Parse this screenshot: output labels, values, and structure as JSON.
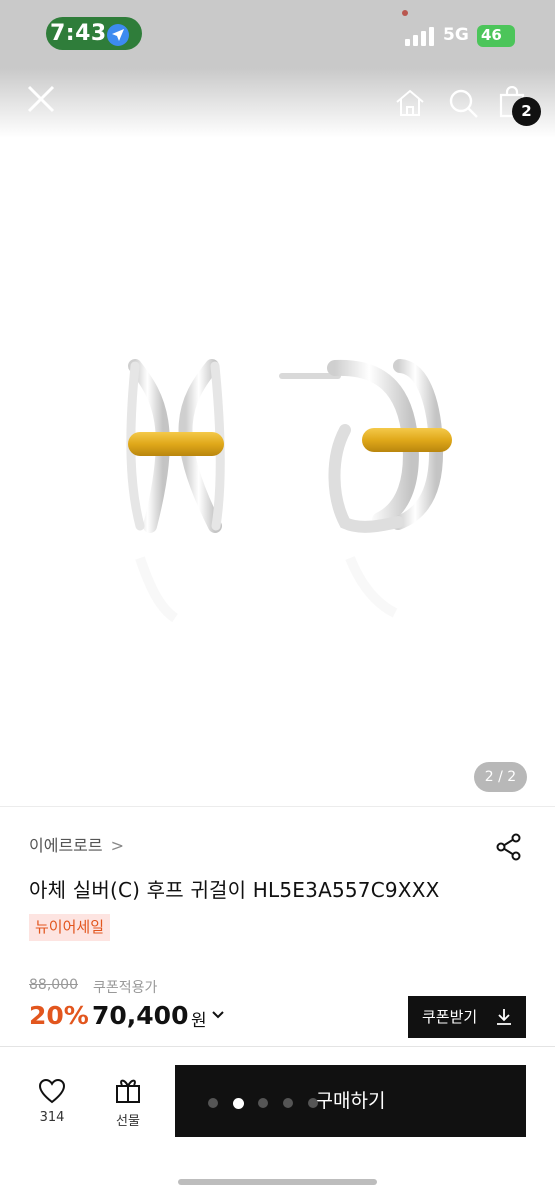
{
  "status_bar": {
    "time": "7:43",
    "network": "5G",
    "battery": "46",
    "icons": [
      "location-arrow-icon",
      "signal-bars-icon",
      "battery-icon"
    ]
  },
  "nav": {
    "cart_count": "2",
    "icons": [
      "close-icon",
      "home-icon",
      "search-icon",
      "shopping-bag-icon"
    ]
  },
  "gallery": {
    "counter": "2 / 2"
  },
  "product": {
    "brand": "이에르로르",
    "brand_chevron": ">",
    "title": "아체 실버(C) 후프 귀걸이 HL5E3A557C9XXX",
    "sale_tag": "뉴이어세일",
    "original_price": "88,000",
    "coupon_note": "쿠폰적용가",
    "discount": "20%",
    "price": "70,400",
    "currency": "원",
    "coupon_button": "쿠폰받기"
  },
  "bottom_bar": {
    "like_count": "314",
    "gift_label": "선물",
    "buy_label": "구매하기",
    "dots_total": 5,
    "dots_active": 1
  },
  "colors": {
    "accent": "#e2561e",
    "sale_tag_bg": "#fde4e1",
    "primary_button": "#111111",
    "gold": "#e0a81a",
    "silver": "#dcdcdc"
  }
}
